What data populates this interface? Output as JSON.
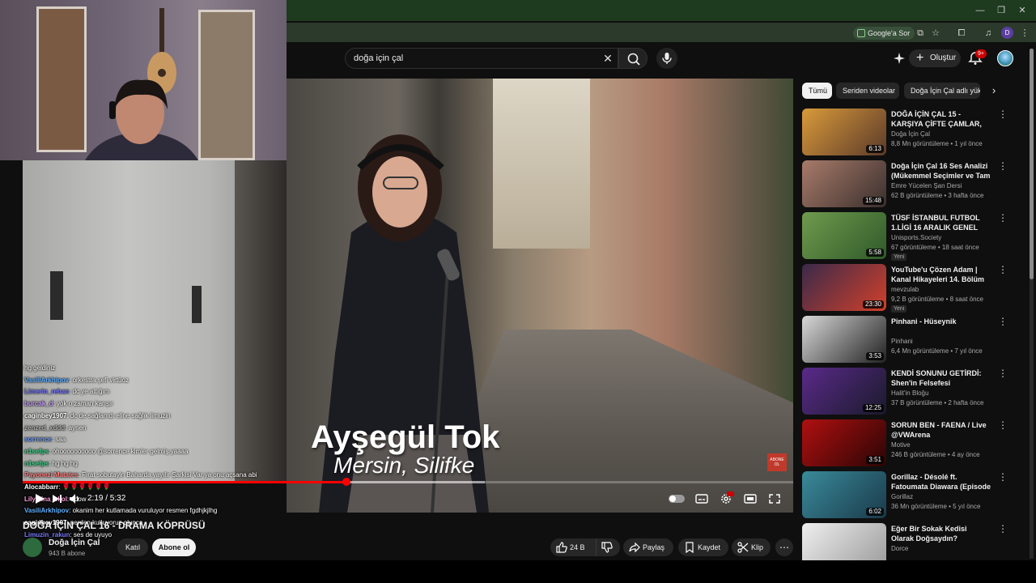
{
  "browser": {
    "google_ask_label": "Google'a Sor",
    "profile_letter": "D"
  },
  "header": {
    "search_query": "doğa için çal",
    "create_label": "Oluştur",
    "notification_count": "9+"
  },
  "video": {
    "overlay_name": "Ayşegül Tok",
    "overlay_place": "Mersin, Silifke",
    "corner_badge": "ABONE OL",
    "current_time": "2:19",
    "duration": "5:32",
    "time_display": "2:19 / 5:32",
    "progress_fraction": 0.42,
    "buffered_fraction": 0.6,
    "title": "DOĞA İÇİN ÇAL 16 - DRAMA KÖPRÜSÜ"
  },
  "channel": {
    "name": "Doğa İçin Çal",
    "subscribers": "943 B abone",
    "join_label": "Katıl",
    "subscribe_label": "Abone ol"
  },
  "actions": {
    "likes": "24 B",
    "share": "Paylaş",
    "save": "Kaydet",
    "clip": "Klip"
  },
  "chat": [
    {
      "user": "",
      "text": "hg geldiniz"
    },
    {
      "user": "VasiliArkhipov",
      "text": ": orkestra şefi virtüoz",
      "color": "#5fb0ff"
    },
    {
      "user": "Limerin_rehan",
      "text": ": dc ye attığım",
      "color": "#7a7aff"
    },
    {
      "user": "burcak_d",
      "text": ": yok o zaman karışır",
      "color": "#c89cff"
    },
    {
      "user": "caginbey1907",
      "text": ": dc de sağlamdı eline sağlık limuzin",
      "color": "#ffffff"
    },
    {
      "user": "zenzed_xddd",
      "text": ": aynen",
      "color": "#b0b0b0"
    },
    {
      "user": "sorrence",
      "text": ": saa",
      "color": "#6a9eff"
    },
    {
      "user": "n1sefps",
      "text": ": ohoooooooooo @sorrence kimler gelmiş yaaaa",
      "color": "#3fd38a"
    },
    {
      "user": "n1sefps",
      "text": ": hg hg hg",
      "color": "#3fd38a"
    },
    {
      "user": "Payonezi Matates",
      "text": ": Fırat sobutayin Baharda yayılır Şarkisi Var ya onu açsana abi",
      "color": "#ff7f7f"
    },
    {
      "user": "Alocabbarr",
      "text": ": 🌹🌹🌹🌹🌹🌹",
      "color": "#ffffff"
    },
    {
      "user": "Lilymina_ekol",
      "text": ": abow",
      "color": "#ff9ad5"
    },
    {
      "user": "VasiliArkhipov",
      "text": ": okanim her kutlamada vuruluyor resmen fgdhjkjlhg",
      "color": "#5fb0ff"
    },
    {
      "user": "caginbey1907",
      "text": ": nerden kutluyoruz olunca",
      "color": "#ffffff"
    },
    {
      "user": "Limuzin_rakun",
      "text": ": ses de uyuyo",
      "color": "#7a7aff"
    }
  ],
  "chips": [
    {
      "label": "Tümü",
      "active": true
    },
    {
      "label": "Seriden videolar",
      "active": false
    },
    {
      "label": "Doğa İçin Çal adlı yükleyiciden",
      "active": false
    }
  ],
  "recommendations": [
    {
      "title": "DOĞA İÇİN ÇAL 15 - KARŞIYA ÇİFTE ÇAMLAR, KIZILCIKLAR ...",
      "channel": "Doğa İçin Çal",
      "meta": "8,8 Mn görüntüleme • 1 yıl önce",
      "duration": "6:13",
      "isnew": false,
      "thumb": [
        "#d99a3a",
        "#5b3a2a"
      ]
    },
    {
      "title": "Doğa İçin Çal 16 Ses Analizi (Mükemmel Seçimler ve Tam ...",
      "channel": "Emre Yücelen Şan Dersi",
      "meta": "62 B görüntüleme • 3 hafta önce",
      "duration": "15:48",
      "isnew": false,
      "thumb": [
        "#a87b6a",
        "#3a2f2d"
      ]
    },
    {
      "title": "TÜSF İSTANBUL FUTBOL 1.LİGİ 16 ARALIK GENEL ÖZET",
      "channel": "Unisports.Society",
      "meta": "67 görüntüleme • 18 saat önce",
      "duration": "5:58",
      "isnew": true,
      "thumb": [
        "#6f9a4d",
        "#2f5a2a"
      ]
    },
    {
      "title": "YouTube'u Çözen Adam | Kanal Hikayeleri 14. Bölüm",
      "channel": "mevzulab",
      "meta": "9,2 B görüntüleme • 8 saat önce",
      "duration": "23:30",
      "isnew": true,
      "thumb": [
        "#3a2a4a",
        "#d2402a"
      ]
    },
    {
      "title": "Pinhani - Hüseynik",
      "channel": "Pinhani",
      "meta": "6,4 Mn görüntüleme • 7 yıl önce",
      "duration": "3:53",
      "isnew": false,
      "thumb": [
        "#d8d8d8",
        "#222222"
      ]
    },
    {
      "title": "KENDİ SONUNU GETİRDİ: Shen'in Felsefesi",
      "channel": "Halit'in Bloğu",
      "meta": "37 B görüntüleme • 2 hafta önce",
      "duration": "12:25",
      "isnew": false,
      "thumb": [
        "#5a2a8a",
        "#1a1a2a"
      ]
    },
    {
      "title": "SORUN BEN - FAENA / Live @VWArena",
      "channel": "Motive",
      "meta": "246 B görüntüleme • 4 ay önce",
      "duration": "3:51",
      "isnew": false,
      "thumb": [
        "#b01010",
        "#2a0505"
      ]
    },
    {
      "title": "Gorillaz - Désolé ft. Fatoumata Diawara (Episode Two)",
      "channel": "Gorillaz",
      "meta": "36 Mn görüntüleme • 5 yıl önce",
      "duration": "6:02",
      "isnew": false,
      "thumb": [
        "#3a8a9a",
        "#1a3a4a"
      ]
    },
    {
      "title": "Eğer Bir Sokak Kedisi Olarak Doğsaydın?",
      "channel": "Dorce",
      "meta": "",
      "duration": "",
      "isnew": false,
      "thumb": [
        "#efefef",
        "#9a9a9a"
      ]
    }
  ]
}
